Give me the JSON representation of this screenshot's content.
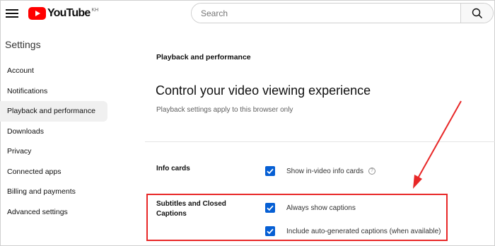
{
  "header": {
    "logo_text": "YouTube",
    "logo_region": "KH",
    "search_placeholder": "Search"
  },
  "sidebar": {
    "title": "Settings",
    "items": [
      {
        "label": "Account"
      },
      {
        "label": "Notifications"
      },
      {
        "label": "Playback and performance",
        "active": true
      },
      {
        "label": "Downloads"
      },
      {
        "label": "Privacy"
      },
      {
        "label": "Connected apps"
      },
      {
        "label": "Billing and payments"
      },
      {
        "label": "Advanced settings"
      }
    ]
  },
  "main": {
    "heading": "Playback and performance",
    "title": "Control your video viewing experience",
    "subtitle": "Playback settings apply to this browser only",
    "info_cards": {
      "label": "Info cards",
      "option": "Show in-video info cards",
      "checked": true
    },
    "subtitles": {
      "label_line1": "Subtitles and Closed",
      "label_line2": "Captions",
      "option1": "Always show captions",
      "option1_checked": true,
      "option2": "Include auto-generated captions (when available)",
      "option2_checked": true
    }
  },
  "colors": {
    "checkbox": "#065fd4",
    "annotation": "#e82727",
    "logo_red": "#ff0000"
  }
}
